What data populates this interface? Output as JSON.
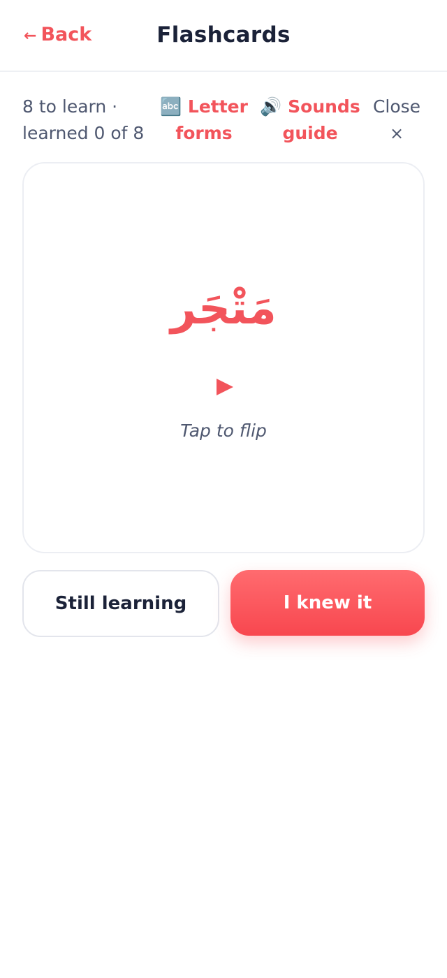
{
  "header": {
    "back_arrow": "←",
    "back_label": "Back",
    "title": "Flashcards"
  },
  "toolbar": {
    "progress_line1": "8 to learn ·",
    "progress_line2": "learned 0 of 8",
    "letter_forms_emoji": "🔤",
    "letter_forms_line1": "Letter",
    "letter_forms_line2": "forms",
    "sounds_emoji": "🔊",
    "sounds_line1": "Sounds",
    "sounds_line2": "guide",
    "close_label": "Close",
    "close_icon": "×"
  },
  "card": {
    "word": "مَتْجَر",
    "play_icon": "play-icon",
    "hint": "Tap to flip"
  },
  "actions": {
    "still_learning": "Still learning",
    "knew_it": "I knew it"
  },
  "colors": {
    "accent": "#f2545b",
    "title": "#1b2238",
    "muted": "#4f5870"
  }
}
